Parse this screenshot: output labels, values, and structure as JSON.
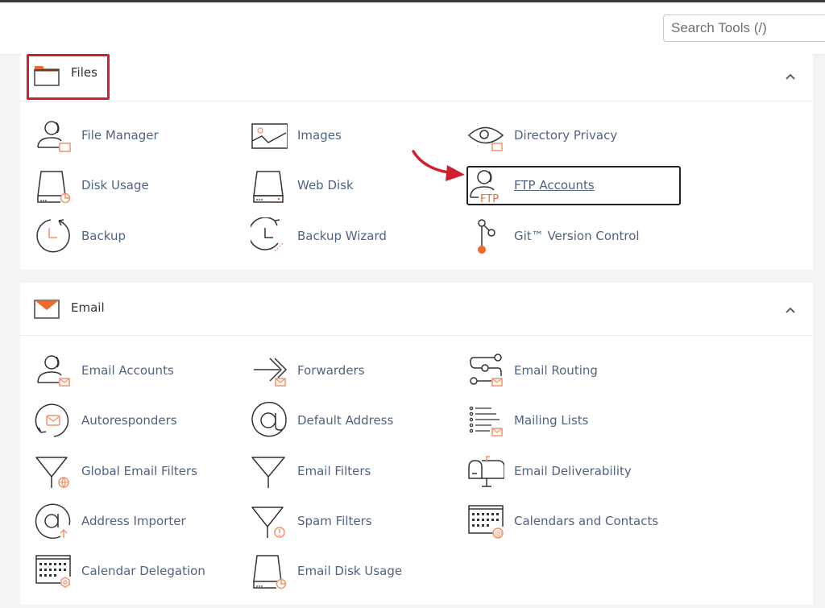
{
  "search": {
    "placeholder": "Search Tools (/)"
  },
  "colors": {
    "accent": "#f26a2a",
    "link_text": "#4f6382",
    "annotation_red": "#d0202e"
  },
  "sections": [
    {
      "title": "Files",
      "icon": "folder-icon",
      "collapse_icon": "chevron-up-icon",
      "items": [
        {
          "label": "File Manager",
          "icon": "file-manager-icon"
        },
        {
          "label": "Images",
          "icon": "images-icon"
        },
        {
          "label": "Directory Privacy",
          "icon": "directory-privacy-icon"
        },
        {
          "label": "Disk Usage",
          "icon": "disk-usage-icon"
        },
        {
          "label": "Web Disk",
          "icon": "web-disk-icon"
        },
        {
          "label": "FTP Accounts",
          "icon": "ftp-accounts-icon"
        },
        {
          "label": "Backup",
          "icon": "backup-icon"
        },
        {
          "label": "Backup Wizard",
          "icon": "backup-wizard-icon"
        },
        {
          "label": "Git™ Version Control",
          "icon": "git-icon"
        }
      ]
    },
    {
      "title": "Email",
      "icon": "envelope-icon",
      "collapse_icon": "chevron-up-icon",
      "items": [
        {
          "label": "Email Accounts",
          "icon": "email-accounts-icon"
        },
        {
          "label": "Forwarders",
          "icon": "forwarders-icon"
        },
        {
          "label": "Email Routing",
          "icon": "email-routing-icon"
        },
        {
          "label": "Autoresponders",
          "icon": "autoresponders-icon"
        },
        {
          "label": "Default Address",
          "icon": "default-address-icon"
        },
        {
          "label": "Mailing Lists",
          "icon": "mailing-lists-icon"
        },
        {
          "label": "Global Email Filters",
          "icon": "global-email-filters-icon"
        },
        {
          "label": "Email Filters",
          "icon": "email-filters-icon"
        },
        {
          "label": "Email Deliverability",
          "icon": "email-deliverability-icon"
        },
        {
          "label": "Address Importer",
          "icon": "address-importer-icon"
        },
        {
          "label": "Spam Filters",
          "icon": "spam-filters-icon"
        },
        {
          "label": "Calendars and Contacts",
          "icon": "calendars-contacts-icon"
        },
        {
          "label": "Calendar Delegation",
          "icon": "calendar-delegation-icon"
        },
        {
          "label": "Email Disk Usage",
          "icon": "email-disk-usage-icon"
        }
      ]
    }
  ]
}
